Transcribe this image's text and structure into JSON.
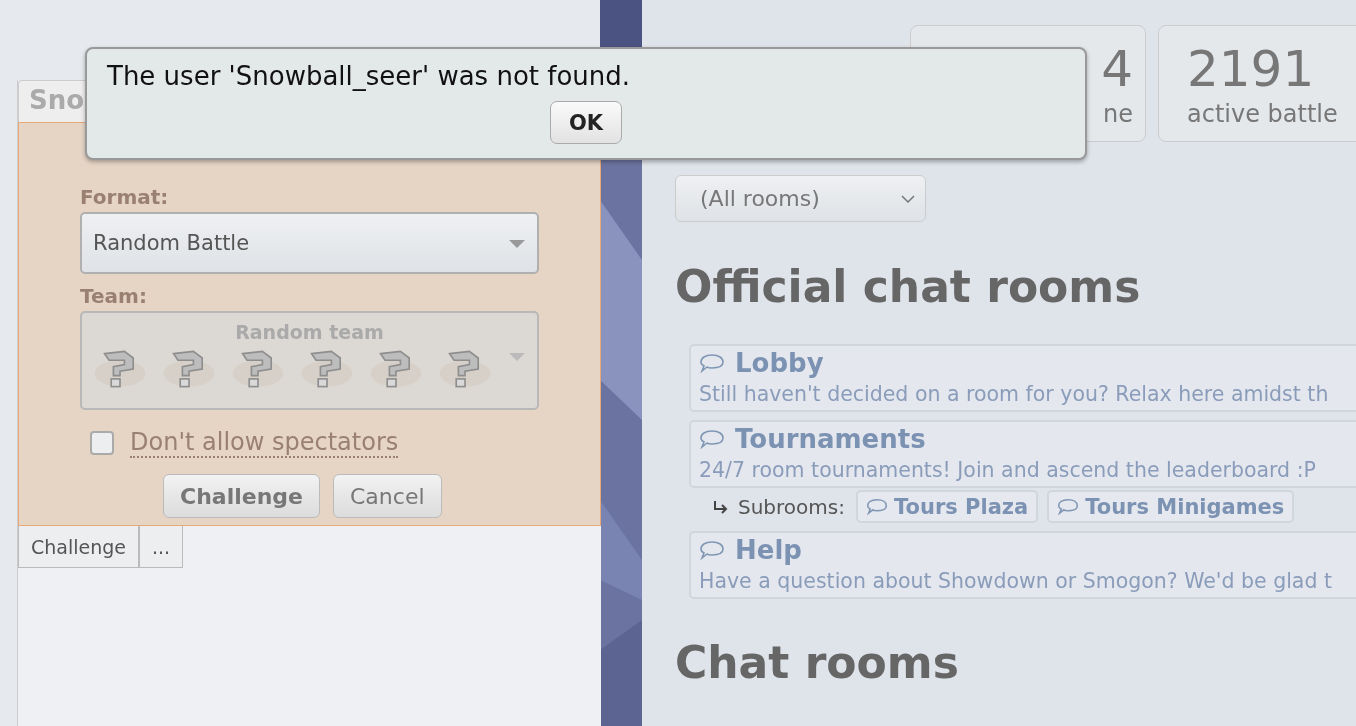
{
  "challenge_window": {
    "title": "Sno",
    "format_label": "Format:",
    "format_value": "Random Battle",
    "team_label": "Team:",
    "team_value": "Random team",
    "team_slots": [
      {
        "kind": "unknown"
      },
      {
        "kind": "unknown"
      },
      {
        "kind": "unknown"
      },
      {
        "kind": "unknown"
      },
      {
        "kind": "unknown"
      },
      {
        "kind": "unknown"
      }
    ],
    "spectators": {
      "label": "Don't allow spectators",
      "checked": false
    },
    "buttons": [
      {
        "label": "Challenge",
        "primary": true
      },
      {
        "label": "Cancel",
        "primary": false
      }
    ],
    "bottom_buttons": [
      "Challenge",
      "..."
    ]
  },
  "stats": [
    {
      "number": "4",
      "label": "ne"
    },
    {
      "number": "2191",
      "label": "active battle"
    }
  ],
  "room_filter": {
    "value": "(All rooms)"
  },
  "official_heading": "Official chat rooms",
  "rooms": [
    {
      "name": "Lobby",
      "description": "Still haven't decided on a room for you? Relax here amidst th"
    },
    {
      "name": "Tournaments",
      "description": "24/7 room tournaments! Join and ascend the leaderboard :P",
      "subrooms_label": "Subrooms:",
      "subrooms": [
        "Tours Plaza",
        "Tours Minigames"
      ]
    },
    {
      "name": "Help",
      "description": "Have a question about Showdown or Smogon? We'd be glad t"
    }
  ],
  "chat_heading": "Chat rooms",
  "alert": {
    "message": "The user 'Snowball_seer' was not found.",
    "button": "OK"
  }
}
